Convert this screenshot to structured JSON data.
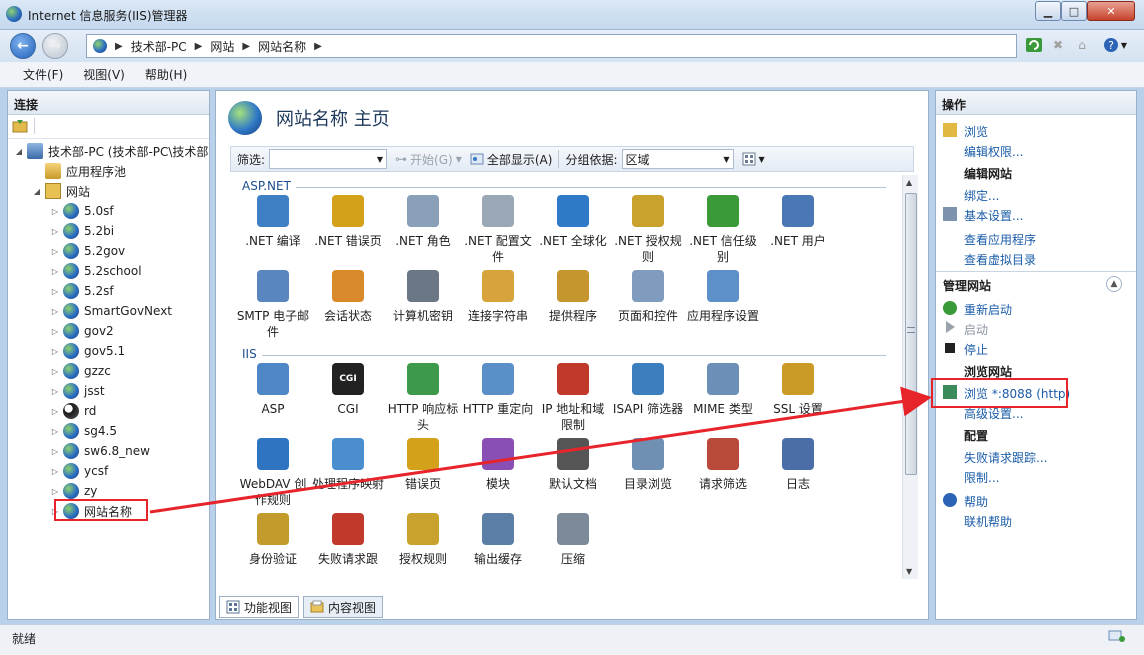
{
  "window": {
    "title": "Internet 信息服务(IIS)管理器"
  },
  "address": {
    "crumbs": [
      "技术部-PC",
      "网站",
      "网站名称"
    ]
  },
  "menu": [
    "文件(F)",
    "视图(V)",
    "帮助(H)"
  ],
  "left": {
    "header": "连接",
    "tree": [
      {
        "label": "技术部-PC (技术部-PC\\技术部",
        "level": 0,
        "icon": "server-icon",
        "expanded": true
      },
      {
        "label": "应用程序池",
        "level": 1,
        "icon": "app-pool-icon"
      },
      {
        "label": "网站",
        "level": 1,
        "icon": "folder-icon",
        "expanded": true
      },
      {
        "label": "5.0sf",
        "level": 2,
        "icon": "globe-icon"
      },
      {
        "label": "5.2bi",
        "level": 2,
        "icon": "globe-icon"
      },
      {
        "label": "5.2gov",
        "level": 2,
        "icon": "globe-icon"
      },
      {
        "label": "5.2school",
        "level": 2,
        "icon": "globe-icon"
      },
      {
        "label": "5.2sf",
        "level": 2,
        "icon": "globe-icon"
      },
      {
        "label": "SmartGovNext",
        "level": 2,
        "icon": "globe-icon"
      },
      {
        "label": "gov2",
        "level": 2,
        "icon": "globe-icon"
      },
      {
        "label": "gov5.1",
        "level": 2,
        "icon": "globe-icon"
      },
      {
        "label": "gzzc",
        "level": 2,
        "icon": "globe-icon"
      },
      {
        "label": "jsst",
        "level": 2,
        "icon": "globe-icon"
      },
      {
        "label": "rd",
        "level": 2,
        "icon": "globe-stopped-icon"
      },
      {
        "label": "sg4.5",
        "level": 2,
        "icon": "globe-icon"
      },
      {
        "label": "sw6.8_new",
        "level": 2,
        "icon": "globe-icon"
      },
      {
        "label": "ycsf",
        "level": 2,
        "icon": "globe-icon"
      },
      {
        "label": "zy",
        "level": 2,
        "icon": "globe-icon"
      },
      {
        "label": "网站名称",
        "level": 2,
        "icon": "globe-icon",
        "selected": true
      }
    ]
  },
  "center": {
    "title": "网站名称 主页",
    "filter": {
      "label": "筛选:",
      "value": "",
      "start": "开始(G)",
      "show_all": "全部显示(A)",
      "group_label": "分组依据:",
      "group_value": "区域"
    },
    "groups": [
      {
        "title": "ASP.NET",
        "items": [
          {
            "label": ".NET 编译",
            "icon": "net-compile-icon",
            "color": "#3f7fc4"
          },
          {
            "label": ".NET 错误页",
            "icon": "net-error-pages-icon",
            "color": "#d4a21a"
          },
          {
            "label": ".NET 角色",
            "icon": "net-roles-icon",
            "color": "#8aa0b8"
          },
          {
            "label": ".NET 配置文件",
            "icon": "net-profile-icon",
            "color": "#9aa7b5"
          },
          {
            "label": ".NET 全球化",
            "icon": "net-globalization-icon",
            "color": "#2f7ac6"
          },
          {
            "label": ".NET 授权规则",
            "icon": "net-authorization-icon",
            "color": "#c9a22e"
          },
          {
            "label": ".NET 信任级别",
            "icon": "net-trust-icon",
            "color": "#3a9a3a"
          },
          {
            "label": ".NET 用户",
            "icon": "net-users-icon",
            "color": "#4a78b4"
          },
          {
            "label": "SMTP 电子邮件",
            "icon": "smtp-email-icon",
            "color": "#5a86c0"
          },
          {
            "label": "会话状态",
            "icon": "session-state-icon",
            "color": "#d88a2a"
          },
          {
            "label": "计算机密钥",
            "icon": "machine-key-icon",
            "color": "#6b7785"
          },
          {
            "label": "连接字符串",
            "icon": "connection-strings-icon",
            "color": "#d6a43a"
          },
          {
            "label": "提供程序",
            "icon": "providers-icon",
            "color": "#c5962e"
          },
          {
            "label": "页面和控件",
            "icon": "pages-controls-icon",
            "color": "#7f9bbd"
          },
          {
            "label": "应用程序设置",
            "icon": "app-settings-icon",
            "color": "#5d8fc9"
          }
        ]
      },
      {
        "title": "IIS",
        "items": [
          {
            "label": "ASP",
            "icon": "asp-icon",
            "color": "#4f86c6"
          },
          {
            "label": "CGI",
            "icon": "cgi-icon",
            "color": "#222222",
            "text": "CGI"
          },
          {
            "label": "HTTP 响应标头",
            "icon": "http-headers-icon",
            "color": "#3d9a4a"
          },
          {
            "label": "HTTP 重定向",
            "icon": "http-redirect-icon",
            "color": "#5b8fc8"
          },
          {
            "label": "IP 地址和域限制",
            "icon": "ip-restrictions-icon",
            "color": "#c0392b"
          },
          {
            "label": "ISAPI 筛选器",
            "icon": "isapi-filters-icon",
            "color": "#3b7fbf"
          },
          {
            "label": "MIME 类型",
            "icon": "mime-types-icon",
            "color": "#6c8fb8"
          },
          {
            "label": "SSL 设置",
            "icon": "ssl-settings-icon",
            "color": "#c99a25"
          },
          {
            "label": "WebDAV 创作规则",
            "icon": "webdav-icon",
            "color": "#2f74c0"
          },
          {
            "label": "处理程序映射",
            "icon": "handler-mappings-icon",
            "color": "#4a8ed0"
          },
          {
            "label": "错误页",
            "icon": "error-pages-icon",
            "color": "#d4a21a"
          },
          {
            "label": "模块",
            "icon": "modules-icon",
            "color": "#8a4fb5"
          },
          {
            "label": "默认文档",
            "icon": "default-document-icon",
            "color": "#555555"
          },
          {
            "label": "目录浏览",
            "icon": "directory-browsing-icon",
            "color": "#6f8fb3"
          },
          {
            "label": "请求筛选",
            "icon": "request-filtering-icon",
            "color": "#b94a3a"
          },
          {
            "label": "日志",
            "icon": "logging-icon",
            "color": "#4b6ea8"
          },
          {
            "label": "身份验证",
            "icon": "authentication-icon",
            "color": "#c39a2c"
          },
          {
            "label": "失败请求跟",
            "icon": "failed-request-icon",
            "color": "#c0392b"
          },
          {
            "label": "授权规则",
            "icon": "authorization-rules-icon",
            "color": "#c9a22e"
          },
          {
            "label": "输出缓存",
            "icon": "output-caching-icon",
            "color": "#5c7fa8"
          },
          {
            "label": "压缩",
            "icon": "compression-icon",
            "color": "#7c8a99"
          }
        ]
      }
    ],
    "tabs": [
      "功能视图",
      "内容视图"
    ]
  },
  "right": {
    "header": "操作",
    "actions": [
      {
        "type": "link",
        "label": "浏览",
        "icon": "explore-icon"
      },
      {
        "type": "link",
        "label": "编辑权限..."
      },
      {
        "type": "title",
        "label": "编辑网站"
      },
      {
        "type": "link",
        "label": "绑定..."
      },
      {
        "type": "link",
        "label": "基本设置...",
        "icon": "basic-settings-icon"
      },
      {
        "type": "spacer"
      },
      {
        "type": "link",
        "label": "查看应用程序"
      },
      {
        "type": "link",
        "label": "查看虚拟目录"
      },
      {
        "type": "section",
        "label": "管理网站"
      },
      {
        "type": "link",
        "label": "重新启动",
        "icon": "restart-icon"
      },
      {
        "type": "disabled",
        "label": "启动",
        "icon": "start-icon"
      },
      {
        "type": "link-dark",
        "label": "停止",
        "icon": "stop-icon"
      },
      {
        "type": "title",
        "label": "浏览网站"
      },
      {
        "type": "link",
        "label": "浏览 *:8088 (http)",
        "icon": "browse-site-icon"
      },
      {
        "type": "link",
        "label": "高级设置..."
      },
      {
        "type": "title",
        "label": "配置"
      },
      {
        "type": "link",
        "label": "失败请求跟踪..."
      },
      {
        "type": "link",
        "label": "限制..."
      },
      {
        "type": "spacer"
      },
      {
        "type": "link",
        "label": "帮助",
        "icon": "help-icon"
      },
      {
        "type": "link",
        "label": "联机帮助"
      }
    ]
  },
  "status": {
    "text": "就绪"
  },
  "colors": {
    "accent": "#1a5ca8",
    "highlight": "#e8242b"
  }
}
